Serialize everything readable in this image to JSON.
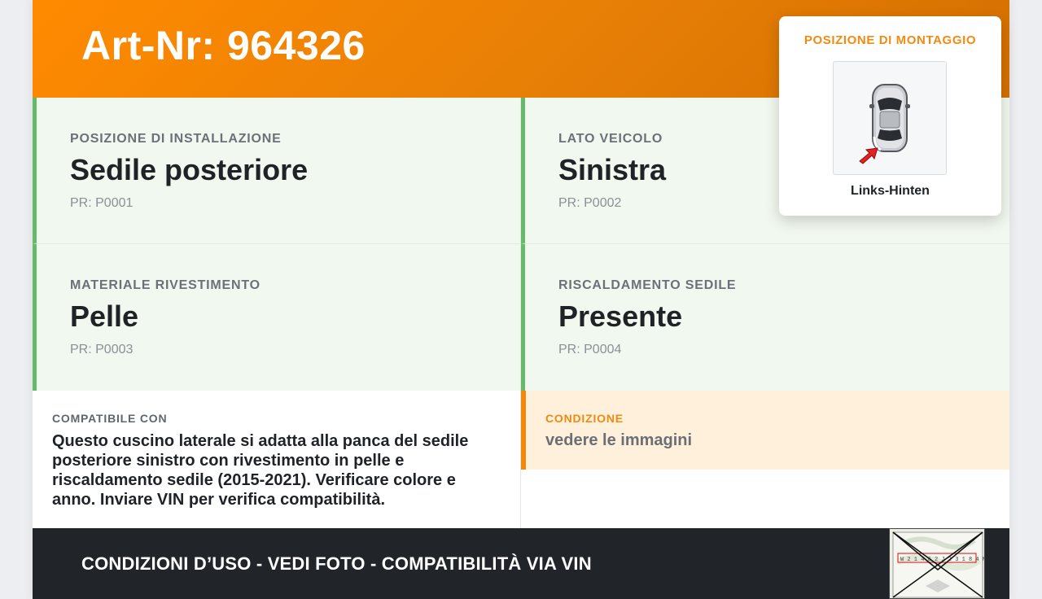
{
  "header": {
    "title": "Art-Nr: 964326"
  },
  "properties": [
    {
      "label": "POSIZIONE DI INSTALLAZIONE",
      "value": "Sedile posteriore",
      "code": "PR: P0001"
    },
    {
      "label": "LATO VEICOLO",
      "value": "Sinistra",
      "code": "PR: P0002"
    },
    {
      "label": "MATERIALE RIVESTIMENTO",
      "value": "Pelle",
      "code": "PR: P0003"
    },
    {
      "label": "RISCALDAMENTO SEDILE",
      "value": "Presente",
      "code": "PR: P0004"
    }
  ],
  "compat": {
    "label": "COMPATIBILE CON",
    "text": "Questo cuscino laterale si adatta alla panca del sedile posteriore sinistro con rivestimento in pelle e riscaldamento sedile (2015-2021). Verificare colore e anno. Inviare VIN per verifica compatibilità."
  },
  "condition": {
    "label": "CONDIZIONE",
    "value": "vedere le immagini"
  },
  "footer": {
    "text": "CONDIZIONI D’USO - VEDI FOTO - COMPATIBILITÀ VIA VIN",
    "thumb_text": "W 2 1 4 6 2 J 2 3 1 8 4 Mercedes-Benz"
  },
  "mounting": {
    "title": "POSIZIONE DI MONTAGGIO",
    "caption": "Links-Hinten",
    "image_icon": "car-top-view-icon",
    "arrow_icon": "rear-left-arrow-icon"
  },
  "colors": {
    "header_orange": "#ff8a00",
    "accent_green": "#66bb6a",
    "condition_orange": "#f08a0c",
    "footer_dark": "#212429"
  }
}
